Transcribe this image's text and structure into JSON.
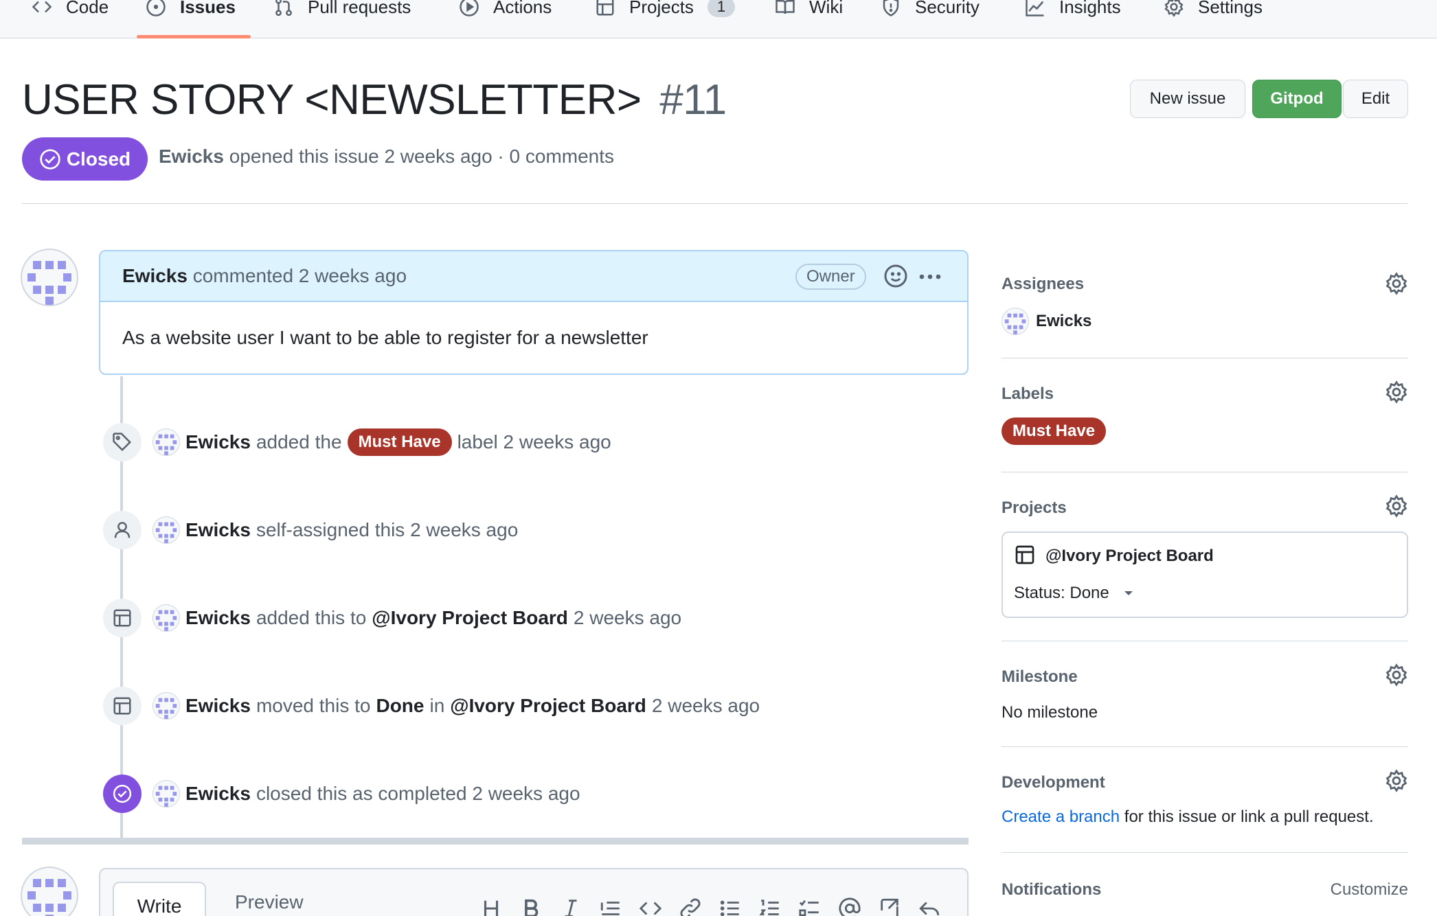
{
  "nav": {
    "items": [
      {
        "label": "Code",
        "icon": "code-icon"
      },
      {
        "label": "Issues",
        "icon": "issue-opened-icon",
        "active": true
      },
      {
        "label": "Pull requests",
        "icon": "git-pull-request-icon"
      },
      {
        "label": "Actions",
        "icon": "play-icon"
      },
      {
        "label": "Projects",
        "icon": "table-icon",
        "count": "1"
      },
      {
        "label": "Wiki",
        "icon": "book-icon"
      },
      {
        "label": "Security",
        "icon": "shield-icon"
      },
      {
        "label": "Insights",
        "icon": "graph-icon"
      },
      {
        "label": "Settings",
        "icon": "gear-icon"
      }
    ]
  },
  "issue": {
    "title": "USER STORY <NEWSLETTER>",
    "number": "#11",
    "state": "Closed",
    "author": "Ewicks",
    "meta_rest": "opened this issue 2 weeks ago · 0 comments"
  },
  "header_buttons": {
    "new_issue": "New issue",
    "gitpod": "Gitpod",
    "edit": "Edit"
  },
  "comment": {
    "author": "Ewicks",
    "action": "commented 2 weeks ago",
    "role": "Owner",
    "body": "As a website user I want to be able to register for a newsletter"
  },
  "timeline": {
    "label_event": {
      "author": "Ewicks",
      "pre": "added the",
      "label": "Must Have",
      "post": "label 2 weeks ago"
    },
    "assign_event": {
      "author": "Ewicks",
      "text": "self-assigned this 2 weeks ago"
    },
    "project_add_event": {
      "author": "Ewicks",
      "pre": "added this to",
      "project": "@Ivory Project Board",
      "post": "2 weeks ago"
    },
    "project_move_event": {
      "author": "Ewicks",
      "pre": "moved this to",
      "column": "Done",
      "mid": "in",
      "project": "@Ivory Project Board",
      "post": "2 weeks ago"
    },
    "close_event": {
      "author": "Ewicks",
      "text": "closed this as completed 2 weeks ago"
    }
  },
  "editor": {
    "write_tab": "Write",
    "preview_tab": "Preview"
  },
  "sidebar": {
    "assignees": {
      "heading": "Assignees",
      "user": "Ewicks"
    },
    "labels": {
      "heading": "Labels",
      "label": "Must Have"
    },
    "projects": {
      "heading": "Projects",
      "board": "@Ivory Project Board",
      "status": "Status: Done"
    },
    "milestone": {
      "heading": "Milestone",
      "value": "No milestone"
    },
    "development": {
      "heading": "Development",
      "link": "Create a branch",
      "rest": "for this issue or link a pull request."
    },
    "notifications": {
      "heading": "Notifications",
      "customize": "Customize"
    }
  },
  "colors": {
    "closed_purple": "#8250df",
    "label_red": "#a9342a",
    "gitpod_green": "#4fa55a",
    "link_blue": "#0969da",
    "comment_header_bg": "#ddf4ff"
  }
}
